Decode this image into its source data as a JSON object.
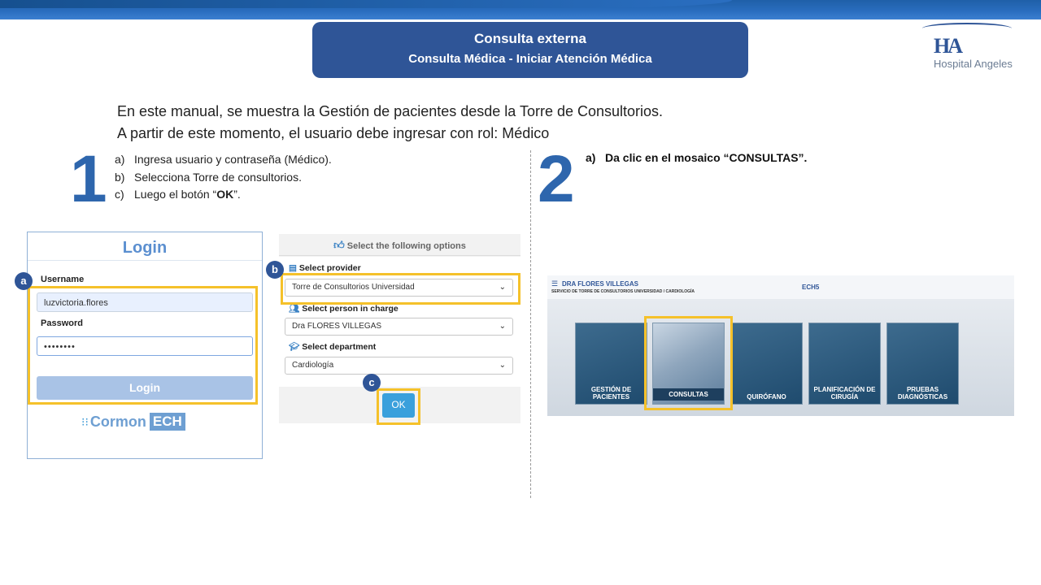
{
  "header": {
    "title": "Consulta externa",
    "subtitle": "Consulta Médica - Iniciar Atención Médica",
    "logo_mark": "HA",
    "logo_name": "Hospital Angeles"
  },
  "intro": {
    "line1": "En este manual, se muestra la Gestión de pacientes desde la Torre de Consultorios.",
    "line2": "A partir de este momento, el usuario debe ingresar con rol: Médico"
  },
  "step1": {
    "number": "1",
    "items": [
      {
        "key": "a)",
        "text": "Ingresa usuario y contraseña (Médico)."
      },
      {
        "key": "b)",
        "text": "Selecciona Torre de consultorios."
      },
      {
        "key": "c)",
        "pre": "Luego el botón “",
        "bold": "OK",
        "post": "”."
      }
    ]
  },
  "step2": {
    "number": "2",
    "key": "a)",
    "text": "Da clic en el mosaico “CONSULTAS”."
  },
  "login": {
    "title": "Login",
    "username_label": "Username",
    "username_value": "luzvictoria.flores",
    "password_label": "Password",
    "password_value": "••••••••",
    "button": "Login",
    "brand_cormon": "Cormon",
    "brand_ech": "ECH"
  },
  "badges": {
    "a": "a",
    "b": "b",
    "c": "c"
  },
  "options": {
    "header": "Select the following options",
    "provider_label": "Select provider",
    "provider_value": "Torre de Consultorios Universidad",
    "person_label": "Select person in charge",
    "person_value": "Dra FLORES VILLEGAS",
    "department_label": "Select department",
    "department_value": "Cardiología",
    "ok_button": "OK"
  },
  "app": {
    "doctor": "DRA FLORES VILLEGAS",
    "service": "SERVICIO DE TORRE DE CONSULTORIOS UNIVERSIDAD / CARDIOLOGÍA",
    "system": "ECH5",
    "tiles": [
      {
        "label": "GESTIÓN DE PACIENTES"
      },
      {
        "label": "CONSULTAS"
      },
      {
        "label": "QUIRÓFANO"
      },
      {
        "label": "PLANIFICACIÓN DE CIRUGÍA"
      },
      {
        "label": "PRUEBAS DIAGNÓSTICAS"
      }
    ]
  },
  "colors": {
    "brand_blue": "#2f5597",
    "highlight": "#f5c12a",
    "number_blue": "#2e66ad"
  },
  "icons": [
    "thumbs-up-icon",
    "clipboard-icon",
    "users-icon",
    "graduation-cap-icon",
    "hamburger-menu-icon",
    "chevron-down-icon"
  ]
}
